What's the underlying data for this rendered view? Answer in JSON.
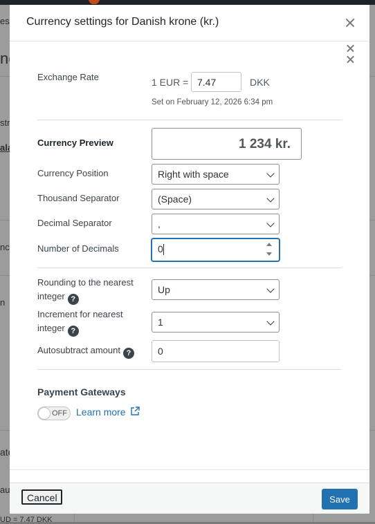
{
  "background": {
    "frag_1": "es,",
    "frag_2": "ne",
    "frag_3": "str",
    "frag_4": "ala",
    "frag_5": "ncy",
    "frag_6": "n",
    "frag_7": "ate",
    "frag_8": "aul",
    "frag_9": "UD = 7.47 DKK"
  },
  "modal": {
    "title": "Currency settings for Danish krone (kr.)",
    "exchange_rate": {
      "label": "Exchange Rate",
      "prefix": "1 EUR =",
      "value": "7.47",
      "suffix": "DKK",
      "note": "Set on February 12, 2026 6:34 pm"
    },
    "currency_preview": {
      "label": "Currency Preview",
      "value": "1 234 kr."
    },
    "currency_position": {
      "label": "Currency Position",
      "selected": "Right with space"
    },
    "thousand_separator": {
      "label": "Thousand Separator",
      "selected": "(Space)"
    },
    "decimal_separator": {
      "label": "Decimal Separator",
      "selected": ","
    },
    "number_of_decimals": {
      "label": "Number of Decimals",
      "value": "0"
    },
    "rounding": {
      "label": "Rounding to the nearest integer",
      "selected": "Up",
      "help": "?"
    },
    "increment": {
      "label": "Increment for nearest integer",
      "selected": "1",
      "help": "?"
    },
    "autosubtract": {
      "label": "Autosubtract amount",
      "value": "0",
      "help": "?"
    },
    "payment_gateways": {
      "title": "Payment Gateways",
      "toggle_state": "OFF",
      "learn_more": "Learn more"
    }
  },
  "footer": {
    "cancel": "Cancel",
    "save": "Save"
  },
  "colors": {
    "accent": "#2271b1",
    "overlay": "#9c9c9c"
  }
}
